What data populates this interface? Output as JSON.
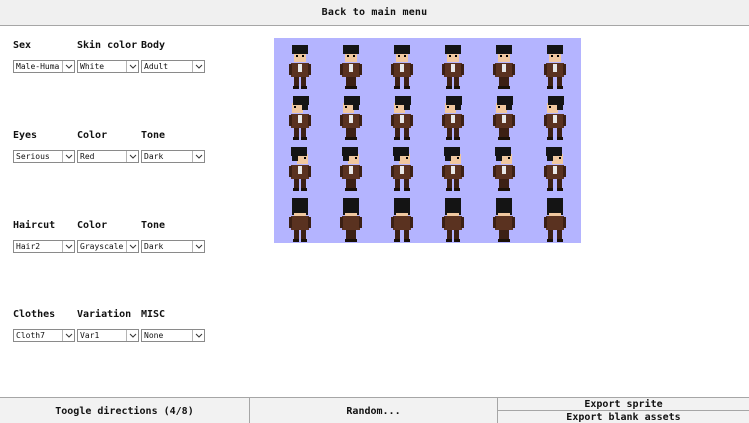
{
  "top_button": "Back to main menu",
  "groups": [
    {
      "labels": [
        "Sex",
        "Skin color",
        "Body"
      ],
      "values": [
        "Male-Human",
        "White",
        "Adult"
      ]
    },
    {
      "labels": [
        "Eyes",
        "Color",
        "Tone"
      ],
      "values": [
        "Serious",
        "Red",
        "Dark"
      ]
    },
    {
      "labels": [
        "Haircut",
        "Color",
        "Tone"
      ],
      "values": [
        "Hair2",
        "Grayscale",
        "Dark"
      ]
    },
    {
      "labels": [
        "Clothes",
        "Variation",
        "MISC"
      ],
      "values": [
        "Cloth7",
        "Var1",
        "None"
      ]
    }
  ],
  "preview": {
    "background": "#b4b4ff",
    "rows": [
      "down",
      "left",
      "right",
      "up"
    ],
    "frames_per_row": 6
  },
  "bottom": {
    "toggle": "Toogle directions (4/8)",
    "random": "Random...",
    "export_sprite": "Export sprite",
    "export_blank": "Export blank assets"
  },
  "colors": {
    "hair": "#141414",
    "skin": "#f0c8a0",
    "coat": "#5a3220",
    "coat_dark": "#3c2014",
    "shirt": "#e8e8e8"
  }
}
